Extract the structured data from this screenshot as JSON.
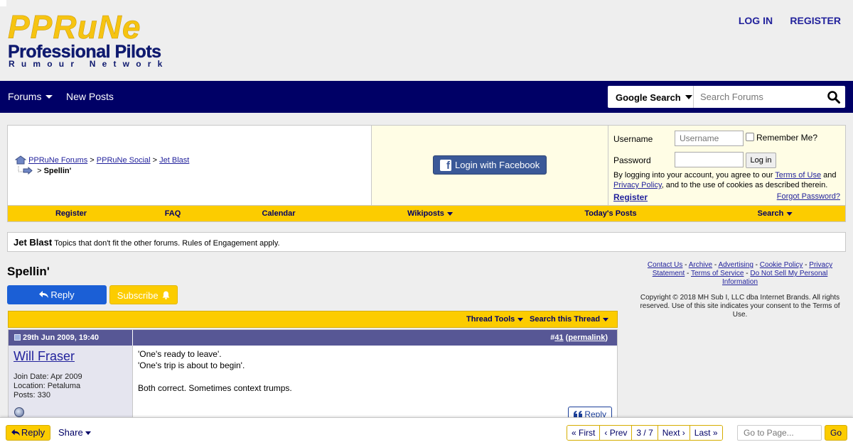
{
  "logo": {
    "line1": "PPRuNe",
    "line2": "Professional Pilots",
    "line3": "Rumour Network"
  },
  "header": {
    "login": "LOG IN",
    "register": "REGISTER"
  },
  "nav": {
    "forums": "Forums",
    "new_posts": "New Posts",
    "search_select": "Google Search",
    "search_placeholder": "Search Forums"
  },
  "breadcrumb": {
    "items": [
      "PPRuNe Forums",
      "PPRuNe Social",
      "Jet Blast"
    ],
    "sep": ">",
    "current": "Spellin'"
  },
  "facebook": {
    "label": "Login with Facebook"
  },
  "login": {
    "username_label": "Username",
    "username_placeholder": "Username",
    "password_label": "Password",
    "remember": "Remember Me?",
    "button": "Log in",
    "terms_pre": "By logging into your account, you agree to our ",
    "terms_link": "Terms of Use",
    "terms_and": " and ",
    "privacy_link": "Privacy Policy",
    "terms_post": ", and to the use of cookies as described therein.",
    "register": "Register",
    "forgot": "Forgot Password?"
  },
  "menu": {
    "register": "Register",
    "faq": "FAQ",
    "calendar": "Calendar",
    "wikiposts": "Wikiposts",
    "todays_posts": "Today's Posts",
    "search": "Search"
  },
  "forum": {
    "name": "Jet Blast",
    "description": "Topics that don't fit the other forums. Rules of Engagement apply."
  },
  "thread": {
    "title": "Spellin'",
    "reply": "Reply",
    "subscribe": "Subscribe",
    "tools": "Thread Tools",
    "search": "Search this Thread"
  },
  "post": {
    "date": "29th Jun 2009, 19:40",
    "number_prefix": "#",
    "number": "41",
    "permalink": "permalink",
    "username": "Will Fraser",
    "join_date": "Join Date: Apr 2009",
    "location": "Location: Petaluma",
    "posts": "Posts: 330",
    "body": [
      "'One's ready to leave'.",
      "'One's trip is about to begin'.",
      "",
      "Both correct. Sometimes context trumps."
    ],
    "reply": "Reply"
  },
  "footer": {
    "links": [
      "Contact Us",
      "Archive",
      "Advertising",
      "Cookie Policy",
      "Privacy Statement",
      "Terms of Service",
      "Do Not Sell My Personal Information"
    ],
    "copyright": "Copyright © 2018 MH Sub I, LLC dba Internet Brands. All rights reserved. Use of this site indicates your consent to the Terms of Use."
  },
  "bottom": {
    "reply": "Reply",
    "share": "Share",
    "first": "First",
    "prev": "Prev",
    "page": "3 / 7",
    "next": "Next",
    "last": "Last",
    "goto_placeholder": "Go to Page...",
    "go": "Go"
  },
  "colors": {
    "navy": "#000066",
    "yellow": "#fccc00",
    "post_header": "#575795",
    "reply_blue": "#1b5fd6",
    "facebook": "#3b5998",
    "link": "#22229c"
  }
}
